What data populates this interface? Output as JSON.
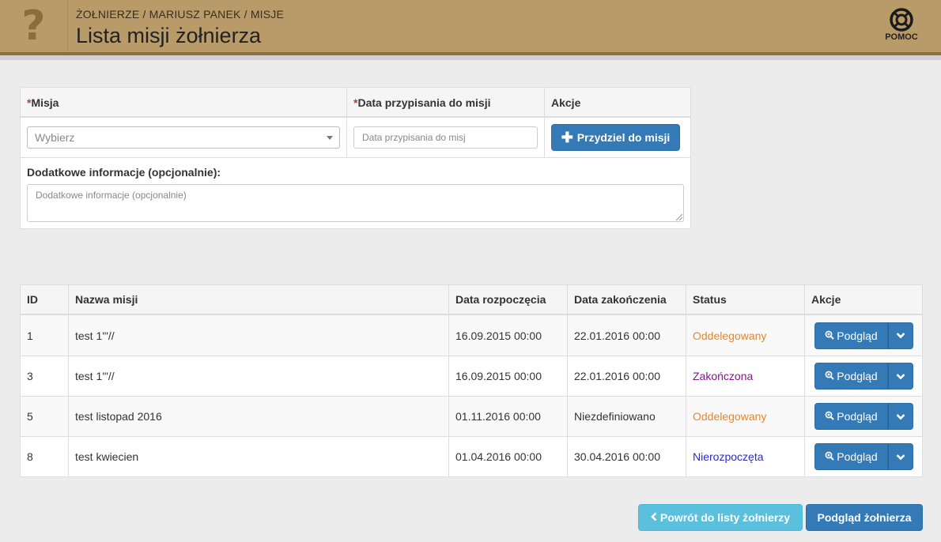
{
  "header": {
    "help_glyph": "?",
    "breadcrumb": "ŻOŁNIERZE / MARIUSZ PANEK / MISJE",
    "title": "Lista misji żołnierza",
    "help_label": "POMOC",
    "help_icon": "lifebuoy-icon"
  },
  "form": {
    "mission_header_req": "*",
    "mission_header": "Misja",
    "date_header_req": "*",
    "date_header": "Data przypisania do misji",
    "actions_header": "Akcje",
    "mission_select_value": "Wybierz",
    "date_placeholder": "Data przypisania do misj",
    "assign_button": "Przydziel do misji",
    "assign_icon": "plus-icon",
    "extra_label": "Dodatkowe informacje (opcjonalnie):",
    "extra_placeholder": "Dodatkowe informacje (opcjonalnie)"
  },
  "table": {
    "columns": [
      "ID",
      "Nazwa misji",
      "Data rozpoczęcia",
      "Data zakończenia",
      "Status",
      "Akcje"
    ],
    "rows": [
      {
        "id": "1",
        "name": "test 1'\"//",
        "start": "16.09.2015 00:00",
        "end": "22.01.2016 00:00",
        "status": "Oddelegowany",
        "status_color": "#e8862b",
        "action": "Podgląd"
      },
      {
        "id": "3",
        "name": "test 1'\"//",
        "start": "16.09.2015 00:00",
        "end": "22.01.2016 00:00",
        "status": "Zakończona",
        "status_color": "#7d1a84",
        "action": "Podgląd"
      },
      {
        "id": "5",
        "name": "test listopad 2016",
        "start": "01.11.2016 00:00",
        "end": "Niezdefiniowano",
        "status": "Oddelegowany",
        "status_color": "#e8862b",
        "action": "Podgląd"
      },
      {
        "id": "8",
        "name": "test kwiecien",
        "start": "01.04.2016 00:00",
        "end": "30.04.2016 00:00",
        "status": "Nierozpoczęta",
        "status_color": "#2a2acd",
        "action": "Podgląd"
      }
    ]
  },
  "footer": {
    "back_button": "Powrót do listy żołnierzy",
    "soldier_button": "Podgląd żołnierza"
  },
  "colors": {
    "header_bg": "#b99a69",
    "primary": "#337ab7",
    "info": "#5bc0de"
  }
}
